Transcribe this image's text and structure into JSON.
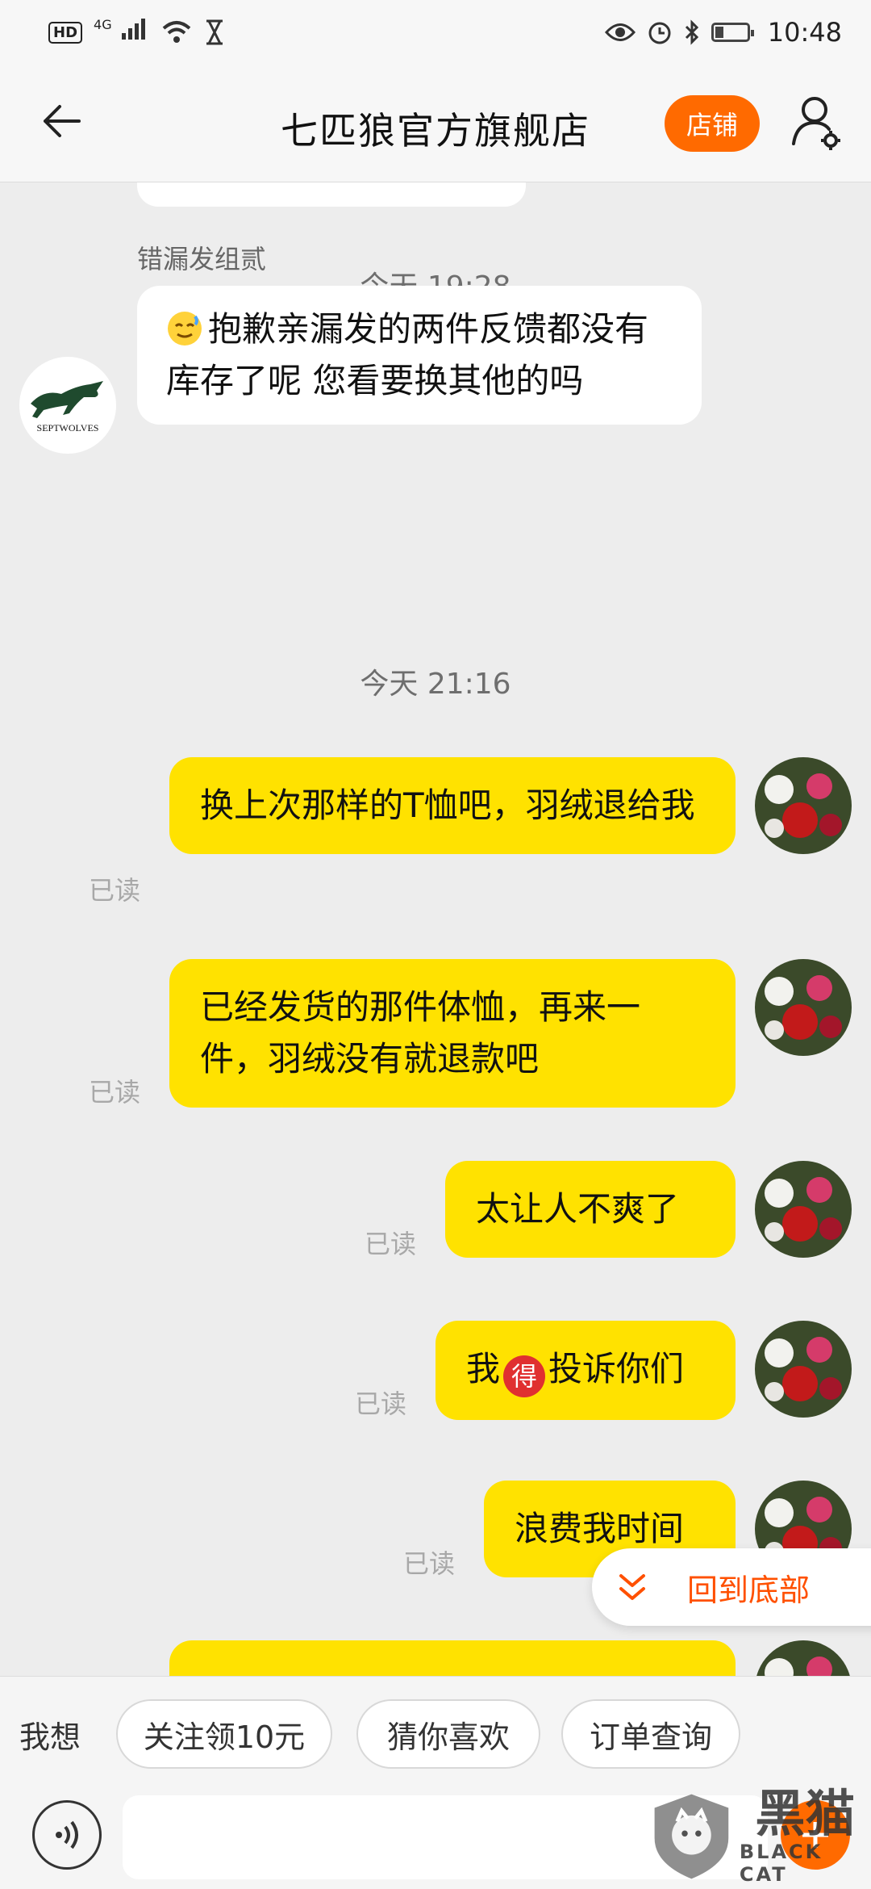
{
  "status_bar": {
    "hd": "HD",
    "network": "4G",
    "time": "10:48"
  },
  "header": {
    "title": "七匹狼官方旗舰店",
    "shop_button": "店铺"
  },
  "chat": {
    "timestamp_1": "今天 19:28",
    "sender_name": "错漏发组贰",
    "logo_text": "SEPTWOLVES",
    "message_1": "抱歉亲漏发的两件反馈都没有库存了呢  您看要换其他的吗",
    "timestamp_2": "今天 21:16",
    "messages": [
      {
        "text": "换上次那样的T恤吧，羽绒退给我",
        "read": "已读"
      },
      {
        "text": "已经发货的那件体恤，再来一件，羽绒没有就退款吧",
        "read": "已读"
      },
      {
        "text": "太让人不爽了",
        "read": "已读"
      },
      {
        "text_before": "我",
        "badge": "得",
        "text_after": "投诉你们",
        "read": "已读"
      },
      {
        "text": "浪费我时间",
        "read": "已读"
      }
    ],
    "scroll_bottom_label": "回到底部"
  },
  "quick_bar": {
    "prompt": "我想",
    "chips": [
      "关注领10元",
      "猜你喜欢",
      "订单查询"
    ]
  },
  "input_bar": {
    "placeholder": ""
  },
  "watermark": {
    "cn": "黑猫",
    "en": "BLACK CAT"
  },
  "colors": {
    "accent": "#ff6a00",
    "bubble_self": "#ffe200",
    "background": "#ededed"
  }
}
